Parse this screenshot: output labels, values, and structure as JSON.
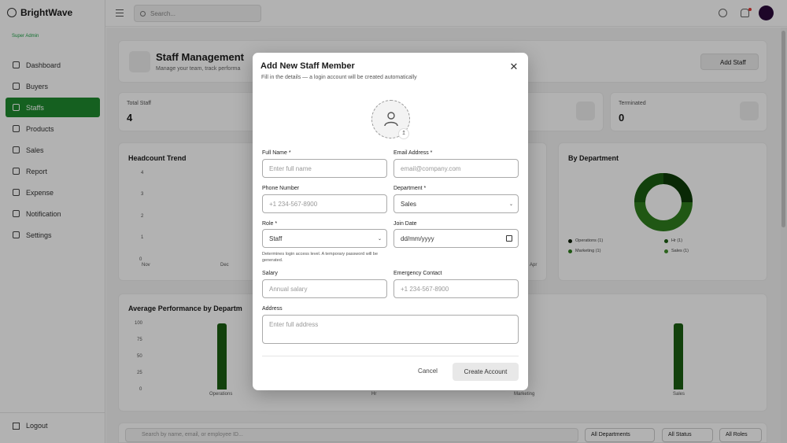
{
  "brand": {
    "name": "BrightWave"
  },
  "user": {
    "role": "Super Admin"
  },
  "sidebar": {
    "items": [
      {
        "label": "Dashboard",
        "icon": "dashboard-icon"
      },
      {
        "label": "Buyers",
        "icon": "users-icon"
      },
      {
        "label": "Staffs",
        "icon": "staff-icon",
        "active": true
      },
      {
        "label": "Products",
        "icon": "box-icon"
      },
      {
        "label": "Sales",
        "icon": "cart-icon"
      },
      {
        "label": "Report",
        "icon": "report-icon"
      },
      {
        "label": "Expense",
        "icon": "wallet-icon"
      },
      {
        "label": "Notification",
        "icon": "bell-icon"
      },
      {
        "label": "Settings",
        "icon": "gear-icon"
      }
    ],
    "logout": "Logout"
  },
  "topbar": {
    "search_placeholder": "Search..."
  },
  "page": {
    "title": "Staff Management",
    "subtitle": "Manage your team, track performa",
    "add_button": "Add Staff"
  },
  "stats": [
    {
      "label": "Total Staff",
      "value": "4"
    },
    {
      "label": "Terminated",
      "value": "0"
    }
  ],
  "charts": {
    "headcount_title": "Headcount Trend",
    "headcount_yticks": [
      "4",
      "3",
      "2",
      "1",
      "0"
    ],
    "headcount_xticks": [
      "Nov",
      "Dec",
      "Apr"
    ],
    "department_title": "By Department",
    "department_legend": [
      "Operations (1)",
      "Hr (1)",
      "Marketing (1)",
      "Sales (1)"
    ],
    "performance_title": "Average Performance by Departm",
    "performance_yticks": [
      "100",
      "75",
      "50",
      "25",
      "0"
    ],
    "performance_categories": [
      "Operations",
      "Hr",
      "Marketing",
      "Sales"
    ]
  },
  "filters": {
    "search_placeholder": "Search by name, email, or employee ID...",
    "departments": "All Departments",
    "status": "All Status",
    "roles": "All Roles"
  },
  "modal": {
    "title": "Add New Staff Member",
    "subtitle": "Fill in the details — a login account will be created automatically",
    "fields": {
      "full_name": {
        "label": "Full Name *",
        "placeholder": "Enter full name"
      },
      "email": {
        "label": "Email Address *",
        "placeholder": "email@company.com"
      },
      "phone": {
        "label": "Phone Number",
        "placeholder": "+1 234-567-8900"
      },
      "department": {
        "label": "Department *",
        "value": "Sales"
      },
      "role": {
        "label": "Role *",
        "value": "Staff",
        "hint": "Determines login access level. A temporary password will be generated."
      },
      "join_date": {
        "label": "Join Date",
        "placeholder": "dd/mm/yyyy"
      },
      "salary": {
        "label": "Salary",
        "placeholder": "Annual salary"
      },
      "emergency": {
        "label": "Emergency Contact",
        "placeholder": "+1 234-567-8900"
      },
      "address": {
        "label": "Address",
        "placeholder": "Enter full address"
      }
    },
    "cancel": "Cancel",
    "create": "Create Account"
  }
}
